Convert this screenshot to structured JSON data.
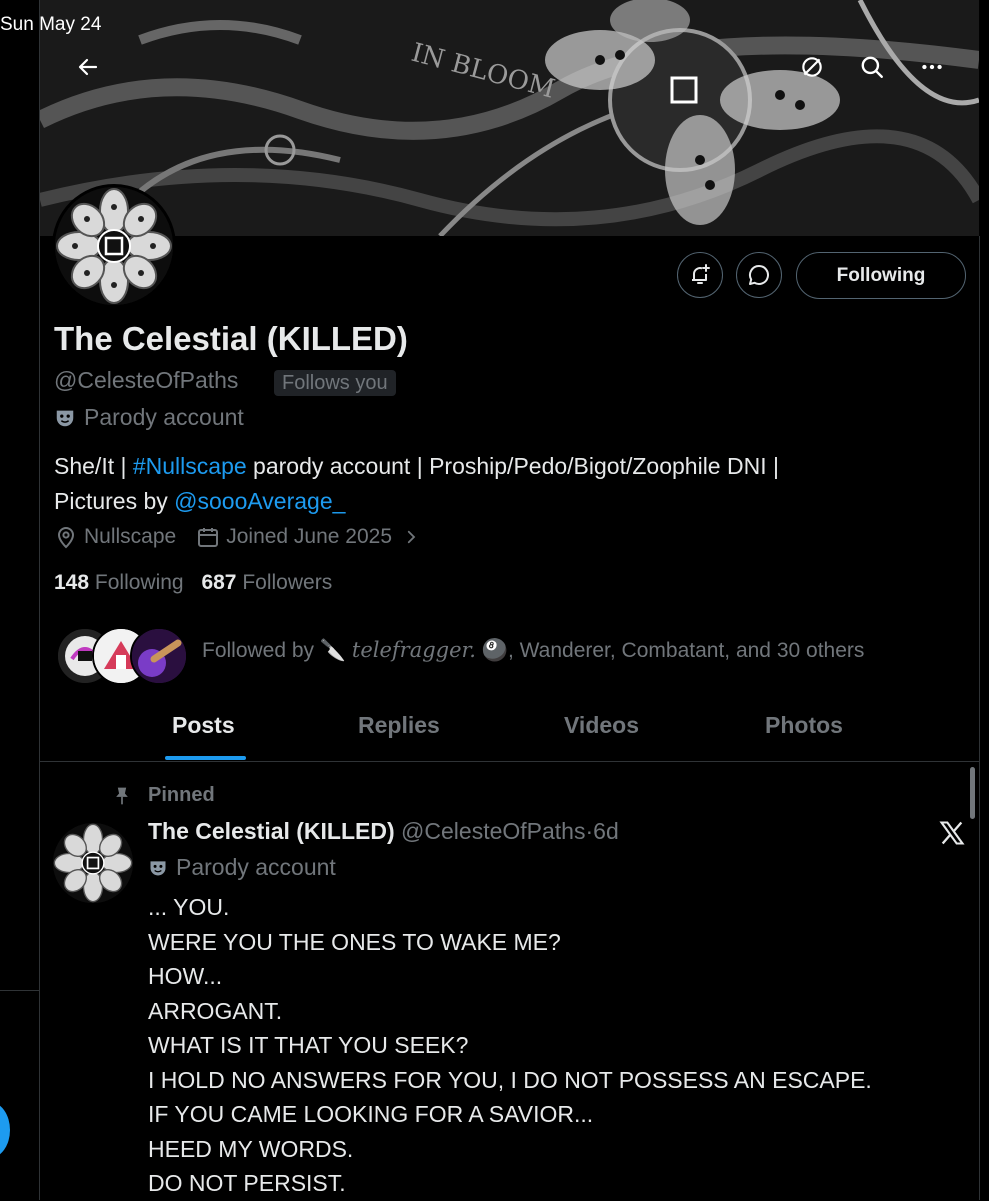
{
  "status_bar": {
    "time": "Sun May 24"
  },
  "profile": {
    "name": "The Celestial (KILLED)",
    "handle": "@CelesteOfPaths",
    "follows_you": "Follows you",
    "parody_label": "Parody account",
    "bio": {
      "part1": "She/It | ",
      "hashtag": "#Nullscape",
      "part2": " parody account | Proship/Pedo/Bigot/Zoophile DNI |",
      "part3": "Pictures by ",
      "mention": "@soooAverage_"
    },
    "location": "Nullscape",
    "joined": "Joined June 2025",
    "following_count": "148",
    "following_label": "Following",
    "followers_count": "687",
    "followers_label": "Followers",
    "follow_button": "Following",
    "followed_by": {
      "prefix": "Followed by ",
      "emoji1": "🔪",
      "name1": "telefragger.",
      "emoji2": "🎱",
      "rest": ", Wanderer, Combatant, and 30 others"
    }
  },
  "tabs": [
    "Posts",
    "Replies",
    "Videos",
    "Photos"
  ],
  "post": {
    "pinned_label": "Pinned",
    "author_name": "The Celestial (KILLED)",
    "author_handle": "@CelesteOfPaths",
    "time_ago": "6d",
    "parody_label": "Parody account",
    "lines": [
      "... YOU.",
      "WERE YOU THE ONES TO WAKE ME?",
      "HOW...",
      "ARROGANT.",
      "WHAT IS IT THAT YOU SEEK?",
      "I HOLD NO ANSWERS FOR YOU, I DO NOT POSSESS AN ESCAPE.",
      "IF YOU CAME LOOKING FOR A SAVIOR...",
      "HEED MY WORDS.",
      "DO NOT PERSIST."
    ]
  },
  "colors": {
    "accent": "#1d9bf0",
    "muted": "#71767b",
    "text": "#e7e9ea",
    "border": "#2f3336"
  },
  "icons": [
    "back-arrow-icon",
    "no-sync-icon",
    "search-icon",
    "more-icon",
    "notification-plus-icon",
    "message-icon",
    "location-icon",
    "calendar-icon",
    "chevron-right-icon",
    "pin-icon",
    "x-logo-icon",
    "parody-mask-icon"
  ]
}
